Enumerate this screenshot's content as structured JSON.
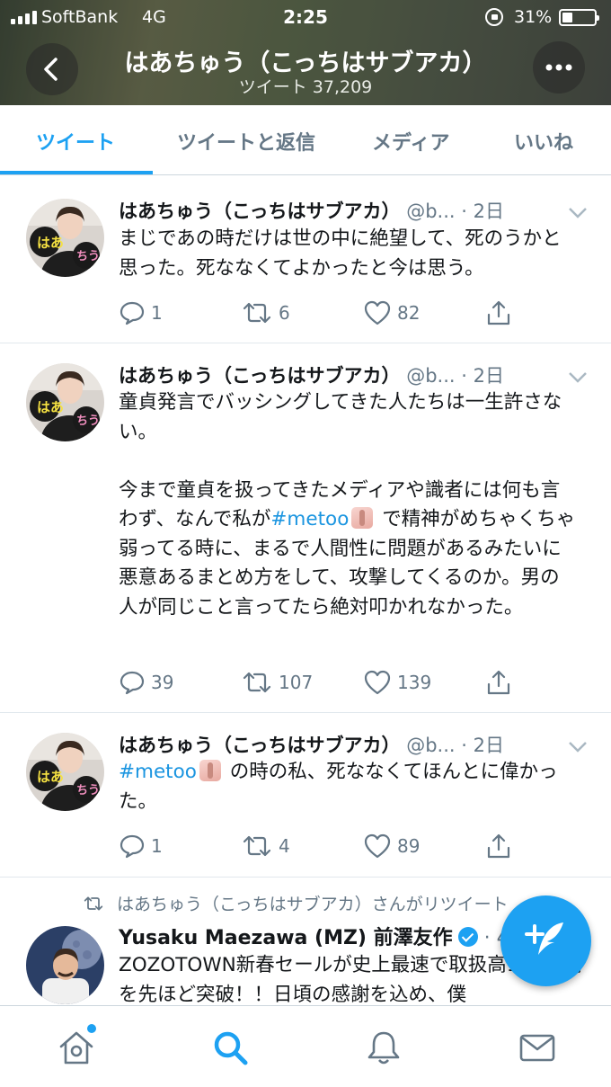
{
  "status_bar": {
    "carrier": "SoftBank",
    "network": "4G",
    "time": "2:25",
    "battery": "31%"
  },
  "header": {
    "title": "はあちゅう（こっちはサブアカ）",
    "subtitle": "ツイート 37,209"
  },
  "tabs": [
    "ツイート",
    "ツイートと返信",
    "メディア",
    "いいね"
  ],
  "tweets": [
    {
      "name": "はあちゅう（こっちはサブアカ）",
      "handle": "@b...",
      "date": "· 2日",
      "body": "まじであの時だけは世の中に絶望して、死のうかと思った。死ななくてよかったと今は思う。",
      "replies": "1",
      "retweets": "6",
      "likes": "82"
    },
    {
      "name": "はあちゅう（こっちはサブアカ）",
      "handle": "@b...",
      "date": "· 2日",
      "body_1": "童貞発言でバッシングしてきた人たちは一生許さない。\n\n今まで童貞を扱ってきたメディアや識者には何も言わず、なんで私が",
      "hashtag": "#metoo",
      "body_2": " で精神がめちゃくちゃ弱ってる時に、まるで人間性に問題があるみたいに悪意あるまとめ方をして、攻撃してくるのか。男の人が同じこと言ってたら絶対叩かれなかった。",
      "replies": "39",
      "retweets": "107",
      "likes": "139"
    },
    {
      "name": "はあちゅう（こっちはサブアカ）",
      "handle": "@b...",
      "date": "· 2日",
      "hashtag": "#metoo",
      "body_2": " の時の私、死ななくてほんとに偉かった。",
      "replies": "1",
      "retweets": "4",
      "likes": "89"
    },
    {
      "retweet_context": "はあちゅう（こっちはサブアカ）さんがリツイート",
      "name": "Yusaku Maezawa (MZ) 前澤友作",
      "handle": "· 4",
      "body": "ZOZOTOWN新春セールが史上最速で取扱高100億円を先ほど突破！！日頃の感謝を込め、僕"
    }
  ],
  "icons": {
    "back": "chevron-left-icon",
    "more": "more-icon",
    "compose": "compose-tweet-icon",
    "nav": [
      "home-icon",
      "search-icon",
      "notifications-icon",
      "messages-icon"
    ]
  },
  "colors": {
    "accent": "#1da1f2",
    "text_secondary": "#657786"
  }
}
